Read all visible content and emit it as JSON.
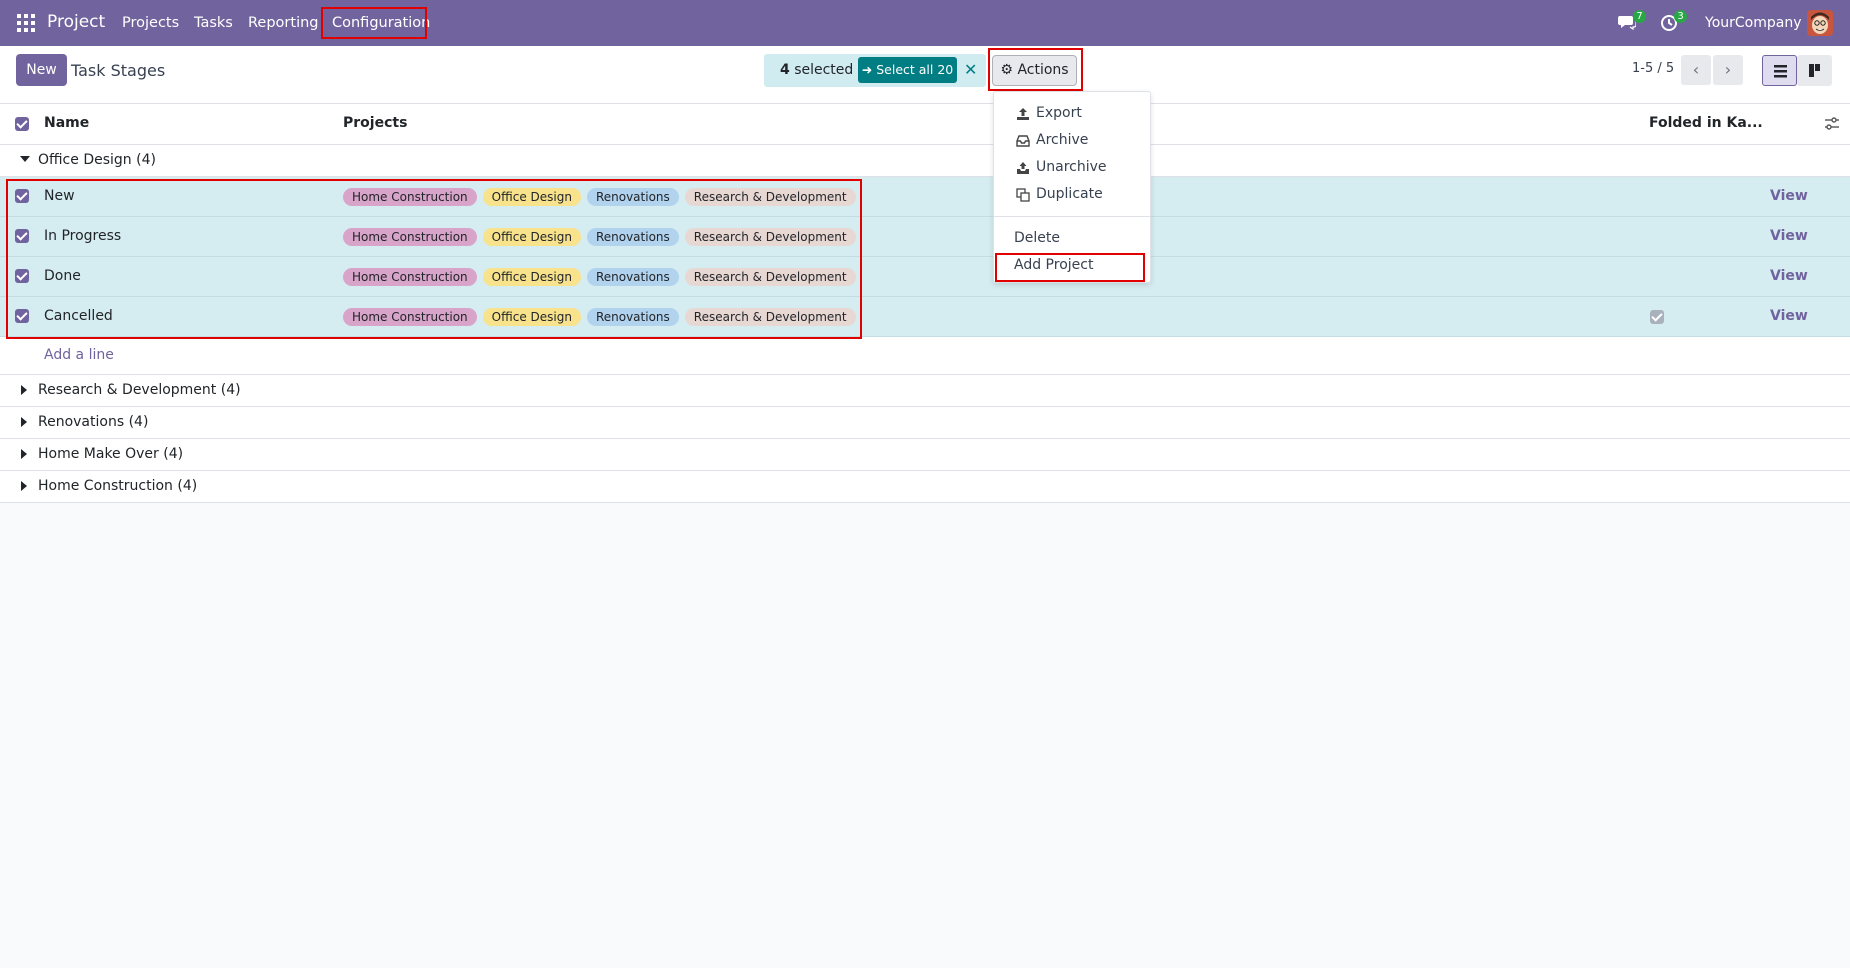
{
  "navbar": {
    "brand": "Project",
    "menu": [
      "Projects",
      "Tasks",
      "Reporting",
      "Configuration"
    ],
    "messages_count": "7",
    "activities_count": "3",
    "company": "YourCompany"
  },
  "control": {
    "new_label": "New",
    "title": "Task Stages",
    "selected_count": "4",
    "selected_suffix": " selected",
    "select_all_label": "Select all 20",
    "actions_label": "Actions",
    "pager": "1-5 / 5"
  },
  "list": {
    "columns": {
      "name": "Name",
      "projects": "Projects",
      "folded": "Folded in Ka..."
    },
    "open_group": "Office Design (4)",
    "rows": [
      {
        "name": "New",
        "tags": [
          "Home Construction",
          "Office Design",
          "Renovations",
          "Research & Development"
        ],
        "folded": false,
        "view": "View"
      },
      {
        "name": "In Progress",
        "tags": [
          "Home Construction",
          "Office Design",
          "Renovations",
          "Research & Development"
        ],
        "folded": false,
        "view": "View"
      },
      {
        "name": "Done",
        "tags": [
          "Home Construction",
          "Office Design",
          "Renovations",
          "Research & Development"
        ],
        "folded": false,
        "view": "View"
      },
      {
        "name": "Cancelled",
        "tags": [
          "Home Construction",
          "Office Design",
          "Renovations",
          "Research & Development"
        ],
        "folded": true,
        "view": "View"
      }
    ],
    "add_line": "Add a line",
    "closed_groups": [
      "Research & Development (4)",
      "Renovations (4)",
      "Home Make Over (4)",
      "Home Construction (4)"
    ]
  },
  "actions_menu": {
    "items": [
      "Export",
      "Archive",
      "Unarchive",
      "Duplicate"
    ],
    "delete": "Delete",
    "add_project": "Add Project"
  },
  "colors": {
    "primary": "#71639e",
    "teal": "#017e84",
    "selected_row": "#d5ecf0",
    "highlight": "#e00000"
  }
}
